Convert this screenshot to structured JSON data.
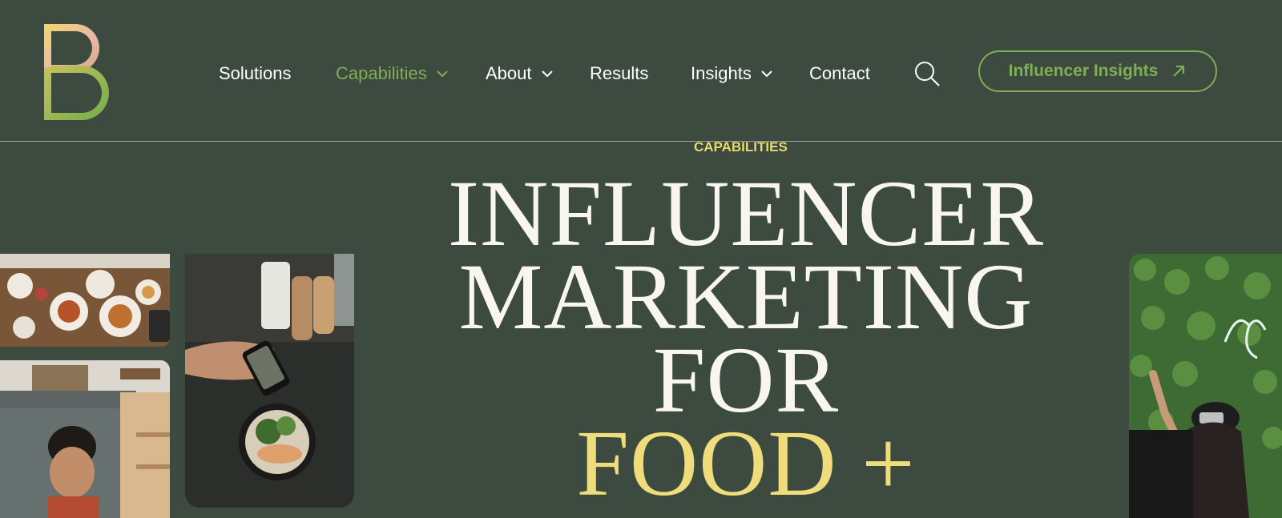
{
  "nav": {
    "items": [
      {
        "label": "Solutions",
        "has_dropdown": false,
        "active": false
      },
      {
        "label": "Capabilities",
        "has_dropdown": true,
        "active": true
      },
      {
        "label": "About",
        "has_dropdown": true,
        "active": false
      },
      {
        "label": "Results",
        "has_dropdown": false,
        "active": false
      },
      {
        "label": "Insights",
        "has_dropdown": true,
        "active": false
      },
      {
        "label": "Contact",
        "has_dropdown": false,
        "active": false
      }
    ],
    "search_icon": "search-icon",
    "cta_label": "Influencer Insights",
    "cta_icon": "arrow-up-right-icon"
  },
  "hero": {
    "eyebrow": "CAPABILITIES",
    "line1": "INFLUENCER",
    "line2": "MARKETING",
    "line3": "FOR",
    "line4a": "FOOD",
    "line4b": "+"
  },
  "colors": {
    "background": "#3d4a3f",
    "accent_green": "#7fae55",
    "accent_yellow": "#efdc7a",
    "text": "#ffffff"
  }
}
